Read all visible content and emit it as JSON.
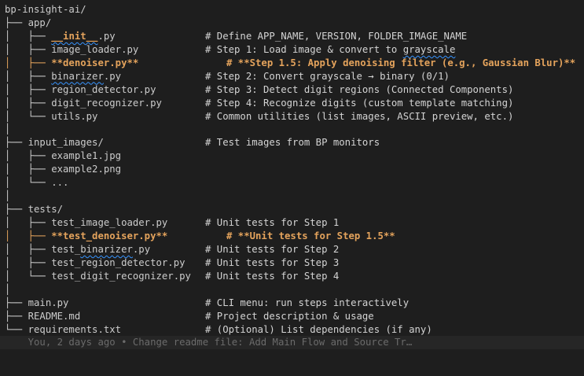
{
  "editor": {
    "lines": [
      {
        "tree": "bp-insight-ai/",
        "comment": ""
      },
      {
        "tree": "├── app/",
        "comment": ""
      },
      {
        "tree_prefix": "│   ├── ",
        "tree_name": "__init__",
        "tree_suffix": ".py",
        "comment": "# Define APP_NAME, VERSION, FOLDER_IMAGE_NAME"
      },
      {
        "tree": "│   ├── image_loader.py",
        "comment_prefix": "# Step 1: Load image & convert to ",
        "comment_name": "grayscale"
      },
      {
        "tree": "│   ├── **denoiser.py**",
        "comment": "# **Step 1.5: Apply denoising filter (e.g., Gaussian Blur)**"
      },
      {
        "tree_prefix": "│   ├── ",
        "tree_name": "binarizer",
        "tree_suffix": ".py",
        "comment": "# Step 2: Convert grayscale → binary (0/1)"
      },
      {
        "tree": "│   ├── region_detector.py",
        "comment": "# Step 3: Detect digit regions (Connected Components)"
      },
      {
        "tree": "│   ├── digit_recognizer.py",
        "comment": "# Step 4: Recognize digits (custom template matching)"
      },
      {
        "tree": "│   └── utils.py",
        "comment": "# Common utilities (list images, ASCII preview, etc.)"
      },
      {
        "tree": "│",
        "comment": ""
      },
      {
        "tree": "├── input_images/",
        "comment": "# Test images from BP monitors"
      },
      {
        "tree": "│   ├── example1.jpg",
        "comment": ""
      },
      {
        "tree": "│   ├── example2.png",
        "comment": ""
      },
      {
        "tree": "│   └── ...",
        "comment": ""
      },
      {
        "tree": "│",
        "comment": ""
      },
      {
        "tree": "├── tests/",
        "comment": ""
      },
      {
        "tree": "│   ├── test_image_loader.py",
        "comment": "# Unit tests for Step 1"
      },
      {
        "tree": "│   ├── **test_denoiser.py**",
        "comment": "# **Unit tests for Step 1.5**"
      },
      {
        "tree_prefix": "│   ├── test_",
        "tree_name": "binarizer",
        "tree_suffix": ".py",
        "comment": "# Unit tests for Step 2"
      },
      {
        "tree": "│   ├── test_region_detector.py",
        "comment": "# Unit tests for Step 3"
      },
      {
        "tree": "│   └── test_digit_recognizer.py",
        "comment": "# Unit tests for Step 4"
      },
      {
        "tree": "│",
        "comment": ""
      },
      {
        "tree": "├── main.py",
        "comment": "# CLI menu: run steps interactively"
      },
      {
        "tree": "├── README.md",
        "comment": "# Project description & usage"
      },
      {
        "tree": "└── requirements.txt",
        "comment": "# (Optional) List dependencies (if any)"
      }
    ],
    "blame_text": "    You, 2 days ago • Change readme file: Add Main Flow and Source Tr…"
  }
}
